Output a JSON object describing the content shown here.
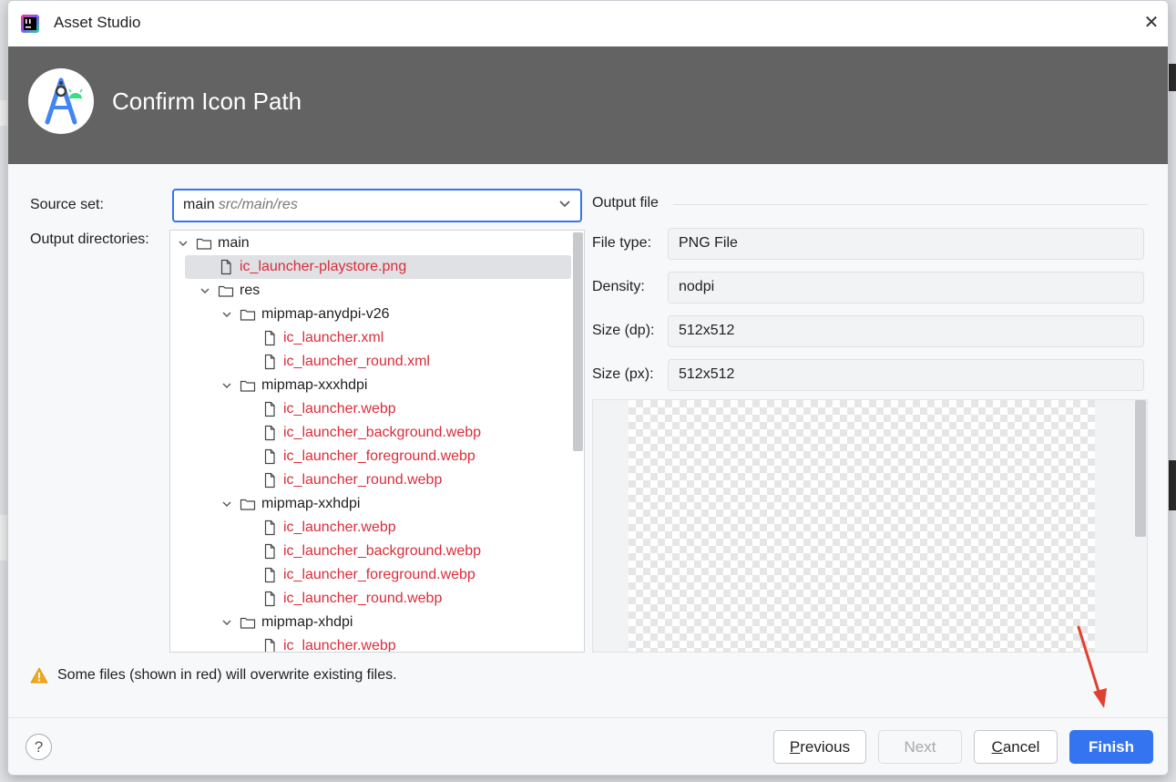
{
  "window": {
    "title": "Asset Studio",
    "close_glyph": "✕"
  },
  "banner": {
    "title": "Confirm Icon Path",
    "logo_icon": "android-studio-logo-icon"
  },
  "form": {
    "source_set_label": "Source set:",
    "source_set_value": "main",
    "source_set_path": "src/main/res",
    "output_dirs_label": "Output directories:"
  },
  "tree": {
    "rows": [
      {
        "label": "main",
        "type": "folder",
        "depth": 0,
        "expanded": true,
        "overwrite": false
      },
      {
        "label": "ic_launcher-playstore.png",
        "type": "file",
        "depth": 1,
        "overwrite": true,
        "selected": true
      },
      {
        "label": "res",
        "type": "folder",
        "depth": 1,
        "expanded": true,
        "overwrite": false
      },
      {
        "label": "mipmap-anydpi-v26",
        "type": "folder",
        "depth": 2,
        "expanded": true,
        "overwrite": false
      },
      {
        "label": "ic_launcher.xml",
        "type": "file",
        "depth": 3,
        "overwrite": true
      },
      {
        "label": "ic_launcher_round.xml",
        "type": "file",
        "depth": 3,
        "overwrite": true
      },
      {
        "label": "mipmap-xxxhdpi",
        "type": "folder",
        "depth": 2,
        "expanded": true,
        "overwrite": false
      },
      {
        "label": "ic_launcher.webp",
        "type": "file",
        "depth": 3,
        "overwrite": true
      },
      {
        "label": "ic_launcher_background.webp",
        "type": "file",
        "depth": 3,
        "overwrite": true
      },
      {
        "label": "ic_launcher_foreground.webp",
        "type": "file",
        "depth": 3,
        "overwrite": true
      },
      {
        "label": "ic_launcher_round.webp",
        "type": "file",
        "depth": 3,
        "overwrite": true
      },
      {
        "label": "mipmap-xxhdpi",
        "type": "folder",
        "depth": 2,
        "expanded": true,
        "overwrite": false
      },
      {
        "label": "ic_launcher.webp",
        "type": "file",
        "depth": 3,
        "overwrite": true
      },
      {
        "label": "ic_launcher_background.webp",
        "type": "file",
        "depth": 3,
        "overwrite": true
      },
      {
        "label": "ic_launcher_foreground.webp",
        "type": "file",
        "depth": 3,
        "overwrite": true
      },
      {
        "label": "ic_launcher_round.webp",
        "type": "file",
        "depth": 3,
        "overwrite": true
      },
      {
        "label": "mipmap-xhdpi",
        "type": "folder",
        "depth": 2,
        "expanded": true,
        "overwrite": false
      },
      {
        "label": "ic_launcher.webp",
        "type": "file",
        "depth": 3,
        "overwrite": true
      }
    ]
  },
  "output_file": {
    "section_label": "Output file",
    "file_type_label": "File type:",
    "file_type_value": "PNG File",
    "density_label": "Density:",
    "density_value": "nodpi",
    "size_dp_label": "Size (dp):",
    "size_dp_value": "512x512",
    "size_px_label": "Size (px):",
    "size_px_value": "512x512"
  },
  "warning": {
    "text": "Some files (shown in red) will overwrite existing files.",
    "icon": "warning-triangle-icon"
  },
  "footer": {
    "help_glyph": "?",
    "previous_first": "P",
    "previous_rest": "revious",
    "next_label": "Next",
    "cancel_first": "C",
    "cancel_rest": "ancel",
    "finish_label": "Finish"
  },
  "colors": {
    "accent": "#3574f0",
    "overwrite_red": "#d92e3a",
    "banner_bg": "#636363",
    "annotation_arrow": "#e0412f"
  }
}
